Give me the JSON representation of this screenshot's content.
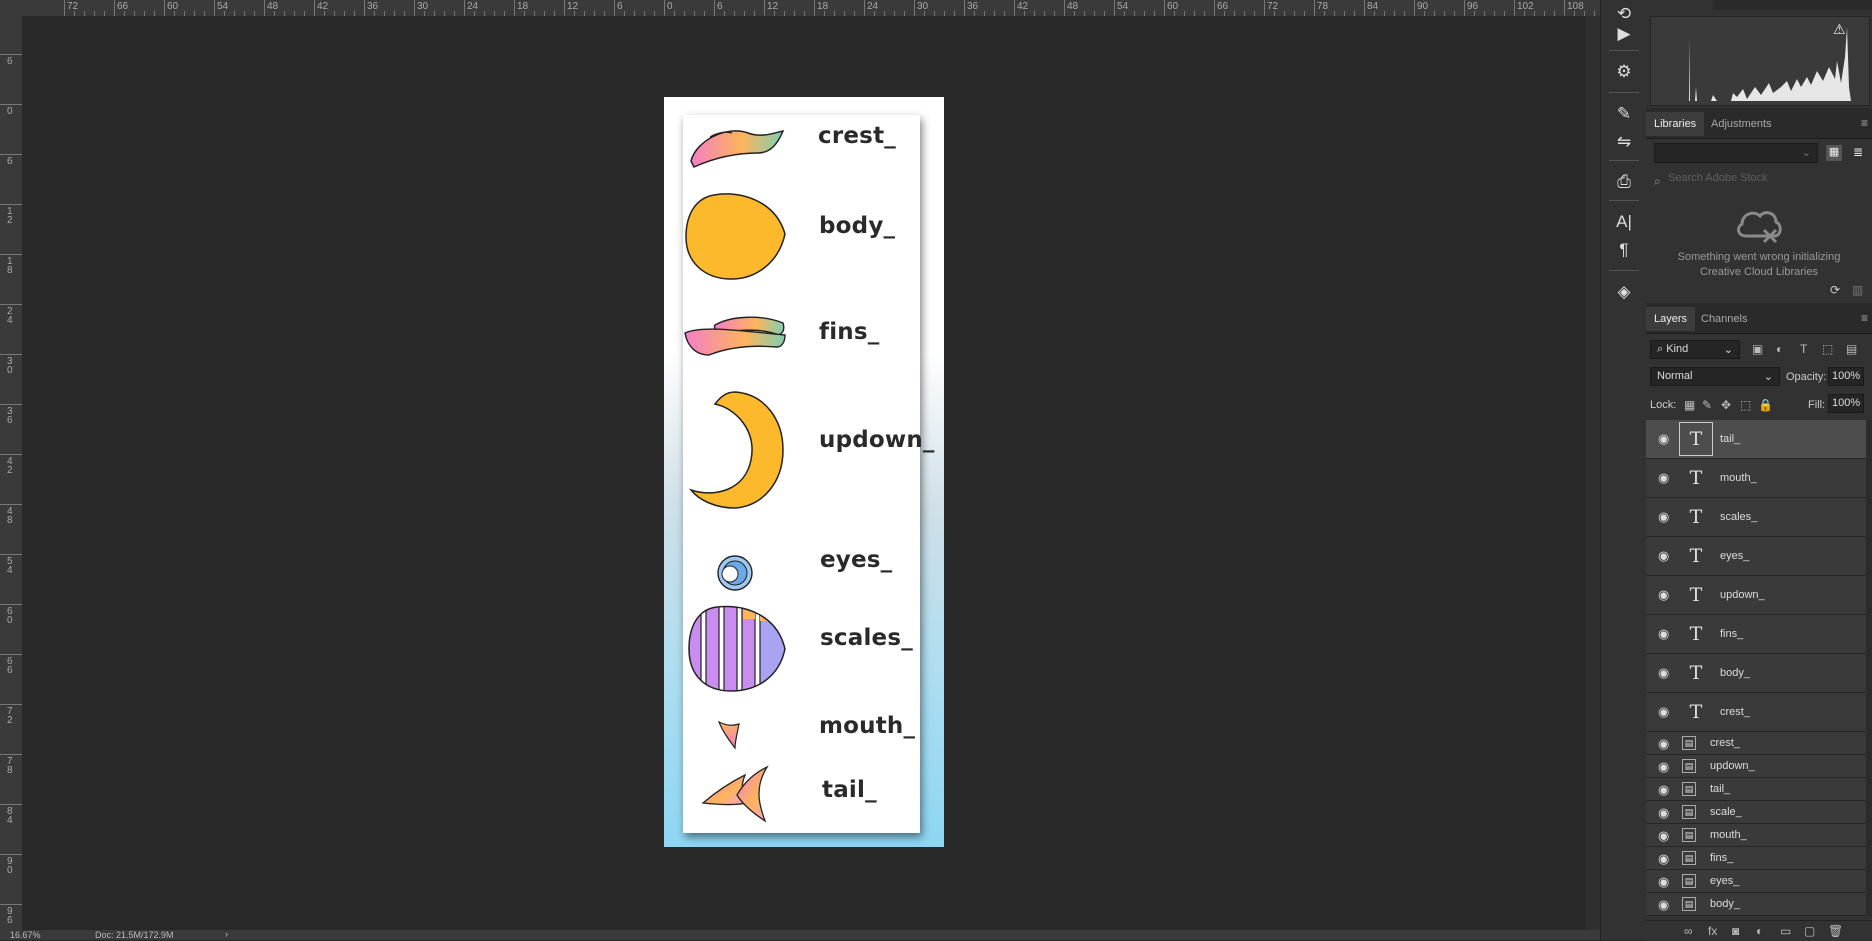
{
  "ruler_top": {
    "labels": [
      "72",
      "66",
      "60",
      "54",
      "48",
      "42",
      "36",
      "30",
      "24",
      "18",
      "12",
      "6",
      "0",
      "6",
      "12",
      "18",
      "24",
      "30",
      "36",
      "42",
      "48",
      "54",
      "60",
      "66",
      "72",
      "78",
      "84",
      "90",
      "96",
      "102",
      "108"
    ]
  },
  "ruler_left": {
    "labels": [
      "6",
      "0",
      "6",
      "12",
      "18",
      "24",
      "30",
      "36",
      "42",
      "48",
      "54",
      "60",
      "66",
      "72",
      "78",
      "84",
      "90",
      "96"
    ]
  },
  "status": {
    "zoom": "16.67%",
    "doc": "Doc: 21.5M/172.9M",
    "arrow": "›"
  },
  "document": {
    "parts": [
      {
        "label": "crest_"
      },
      {
        "label": "body_"
      },
      {
        "label": "fins_"
      },
      {
        "label": "updown_"
      },
      {
        "label": "eyes_"
      },
      {
        "label": "scales_"
      },
      {
        "label": "mouth_"
      },
      {
        "label": "tail_"
      }
    ]
  },
  "tools": {
    "icons": [
      "history-brush-icon",
      "play-icon",
      "properties-icon",
      "brush-icon",
      "brush-presets-icon",
      "clone-source-icon",
      "character-icon",
      "paragraph-icon",
      "3d-icon"
    ],
    "glyphs": [
      "⟲",
      "▶",
      "⚙",
      "✎",
      "⇋",
      "⎙",
      "A|",
      "¶",
      "◈"
    ]
  },
  "histogram": {
    "warning": "⚠"
  },
  "libraries": {
    "tabs": [
      "Libraries",
      "Adjustments"
    ],
    "search_placeholder": "Search Adobe Stock",
    "error_text_line1": "Something went wrong initializing",
    "error_text_line2": "Creative Cloud Libraries",
    "menu": "≡"
  },
  "layers_panel": {
    "tabs": [
      "Layers",
      "Channels"
    ],
    "kind_label": "Kind",
    "blend_mode": "Normal",
    "opacity_label": "Opacity:",
    "opacity_value": "100%",
    "lock_label": "Lock:",
    "fill_label": "Fill:",
    "fill_value": "100%",
    "menu": "≡",
    "text_layers": [
      "tail_",
      "mouth_",
      "scales_",
      "eyes_",
      "updown_",
      "fins_",
      "body_",
      "crest_"
    ],
    "smart_layers": [
      "crest_",
      "updown_",
      "tail_",
      "scale_",
      "mouth_",
      "fins_",
      "eyes_",
      "body_"
    ],
    "text_thumb": "T",
    "smart_thumb": "▤",
    "eye_glyph": "◉",
    "footer_icons": [
      "∞",
      "fx",
      "◙",
      "◐",
      "▭",
      "▢",
      "🗑"
    ]
  }
}
